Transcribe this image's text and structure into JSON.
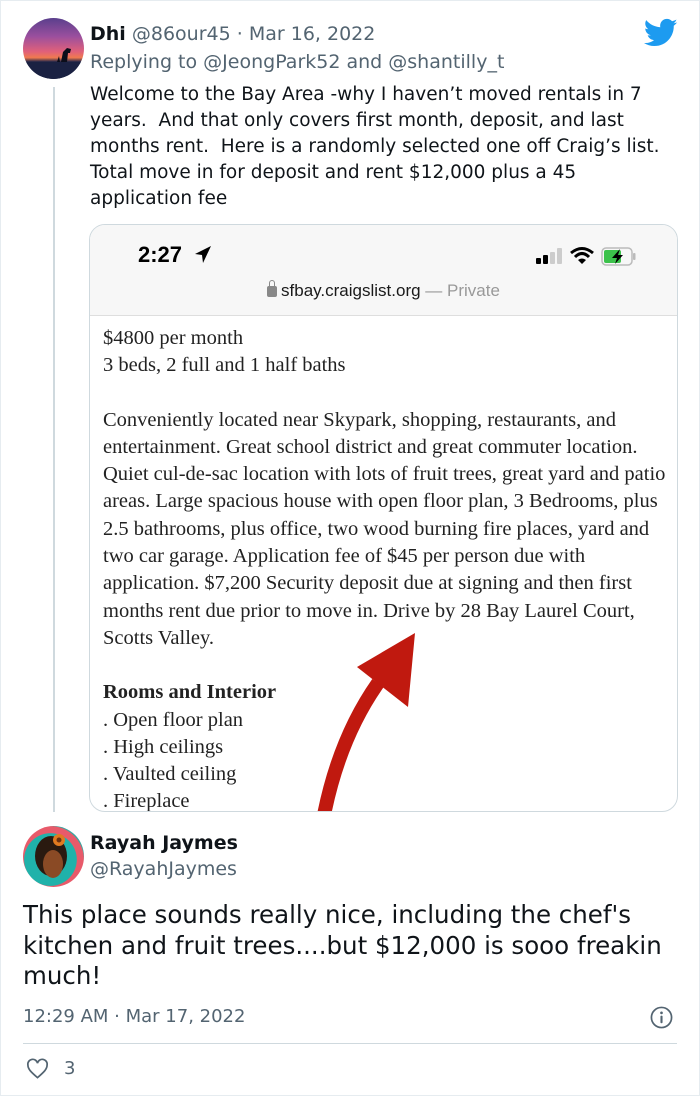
{
  "tweet1": {
    "author_name": "Dhi",
    "author_handle": "@86our45",
    "separator": "·",
    "date": "Mar 16, 2022",
    "replying_label": "Replying to",
    "replying_to_1": "@JeongPark52",
    "replying_and": "and",
    "replying_to_2": "@shantilly_t",
    "text": "Welcome to the Bay Area -why I haven’t moved rentals in 7 years.  And that only covers first month, deposit, and last months rent.  Here is a randomly selected one off Craig’s list.  Total move in for deposit and rent $12,000 plus a 45 application fee",
    "media": {
      "status_time": "2:27",
      "url": "sfbay.craigslist.org",
      "url_suffix": "— Private",
      "listing_price": "$4800 per month",
      "listing_beds": "3 beds, 2 full and 1 half baths",
      "listing_description": "Conveniently located near Skypark, shopping, restaurants, and entertainment. Great school district and great commuter location. Quiet cul-de-sac location with lots of fruit trees, great yard and patio areas. Large spacious house with open floor plan, 3 Bedrooms, plus 2.5 bathrooms, plus office, two wood burning fire places, yard and two car garage. Application fee of $45 per person due with application. $7,200 Security deposit due at signing and then first months rent due prior to move in. Drive by 28 Bay Laurel Court, Scotts Valley.",
      "section_title": "Rooms and Interior",
      "features": [
        ". Open floor plan",
        ". High ceilings",
        ". Vaulted ceiling",
        ". Fireplace"
      ]
    }
  },
  "tweet2": {
    "author_name": "Rayah Jaymes",
    "author_handle": "@RayahJaymes",
    "text": "This place sounds really nice, including the chef's kitchen and fruit trees....but $12,000 is sooo freakin much!",
    "timestamp": "12:29 AM · Mar 17, 2022",
    "like_count": "3"
  },
  "colors": {
    "twitter_blue": "#1d9bf0",
    "muted": "#536471",
    "arrow_red": "#c0190f"
  }
}
